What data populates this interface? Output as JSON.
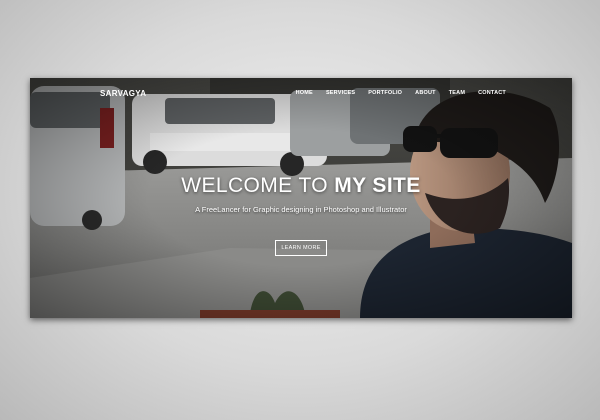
{
  "site": {
    "brand": "SARVAGYA"
  },
  "nav": {
    "items": [
      "HOME",
      "SERVICES",
      "PORTFOLIO",
      "ABOUT",
      "TEAM",
      "CONTACT"
    ]
  },
  "hero": {
    "title_part1": "WELCOME TO ",
    "title_part2": "MY SITE",
    "subtitle": "A FreeLancer for Graphic designing in Photoshop and Illustrator",
    "button_label": "LEARN MORE"
  },
  "colors": {
    "text": "#ffffff",
    "background_outer": "#d9d9d9"
  }
}
